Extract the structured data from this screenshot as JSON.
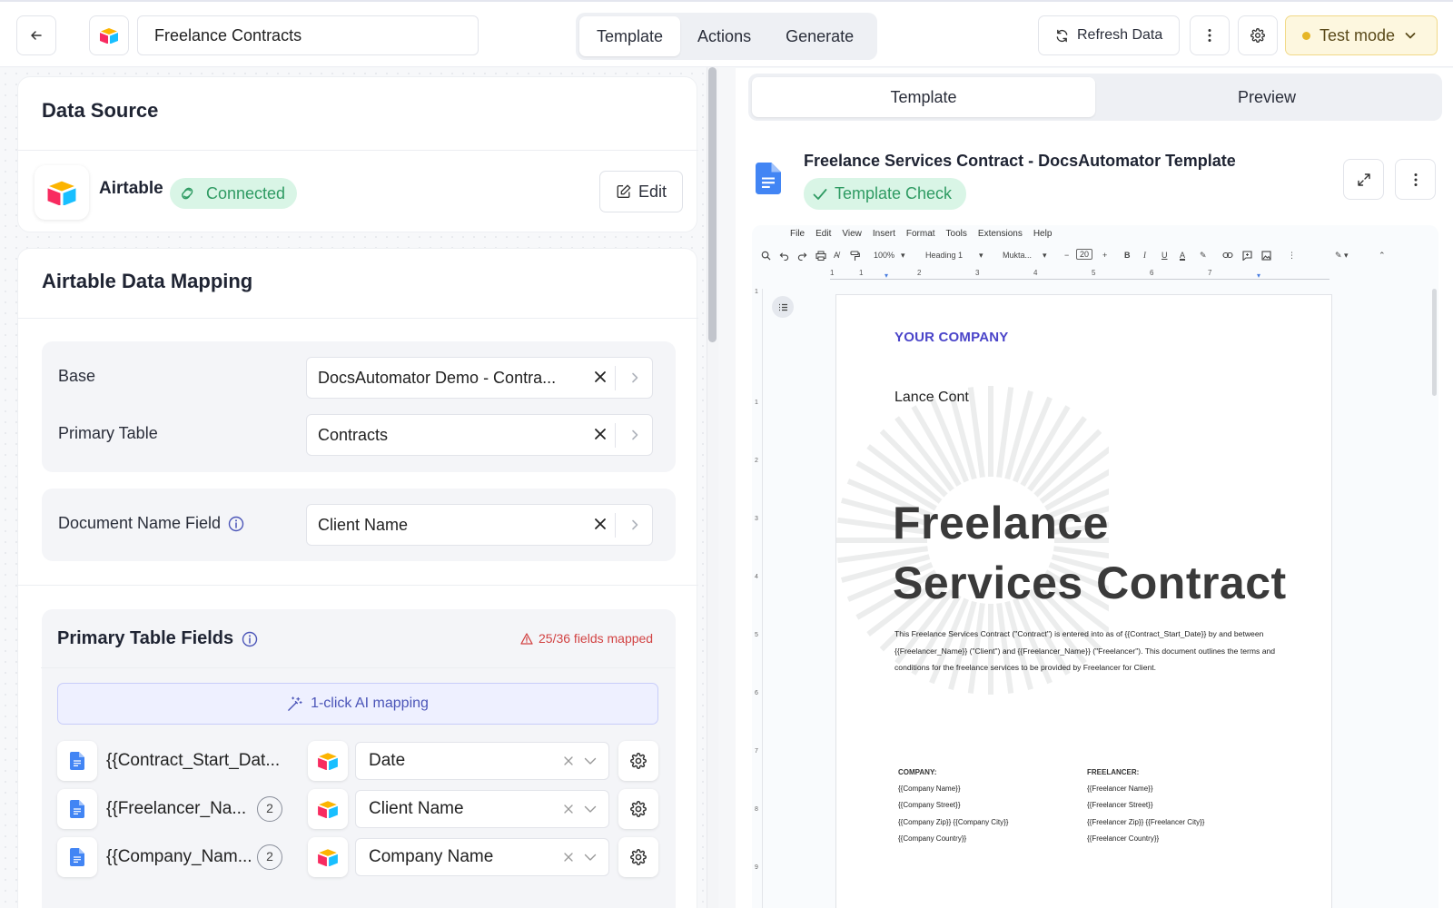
{
  "header": {
    "title": "Freelance Contracts",
    "tabs": [
      "Template",
      "Actions",
      "Generate"
    ],
    "refresh_label": "Refresh Data",
    "test_mode_label": "Test mode"
  },
  "data_source": {
    "title": "Data Source",
    "provider": "Airtable",
    "status": "Connected",
    "edit_label": "Edit"
  },
  "mapping": {
    "title": "Airtable Data Mapping",
    "base_label": "Base",
    "base_value": "DocsAutomator Demo - Contra...",
    "table_label": "Primary Table",
    "table_value": "Contracts",
    "docname_label": "Document Name Field",
    "docname_value": "Client Name"
  },
  "fields": {
    "title": "Primary Table Fields",
    "mapped_status": "25/36 fields mapped",
    "ai_button": "1-click AI mapping",
    "rows": [
      {
        "placeholder": "{{Contract_Start_Dat...",
        "count": "",
        "value": "Date"
      },
      {
        "placeholder": "{{Freelancer_Na...",
        "count": "2",
        "value": "Client Name"
      },
      {
        "placeholder": "{{Company_Nam...",
        "count": "2",
        "value": "Company Name"
      }
    ]
  },
  "preview": {
    "tabs": [
      "Template",
      "Preview"
    ],
    "doc_title": "Freelance Services Contract - DocsAutomator Template",
    "check_label": "Template Check"
  },
  "gdoc": {
    "menu": [
      "File",
      "Edit",
      "View",
      "Insert",
      "Format",
      "Tools",
      "Extensions",
      "Help"
    ],
    "zoom": "100%",
    "style": "Heading 1",
    "font": "Mukta...",
    "font_size": "20",
    "ruler": [
      "1",
      "1",
      "2",
      "3",
      "4",
      "5",
      "6",
      "7"
    ],
    "vruler": [
      "1",
      "1",
      "2",
      "3",
      "4",
      "5",
      "6",
      "7",
      "8",
      "9"
    ],
    "company_header": "YOUR COMPANY",
    "author": "Lance Cont",
    "heading_line1": "Freelance",
    "heading_line2": "Services Contract",
    "intro_text": "This Freelance Services Contract (\"Contract\") is entered into as of {{Contract_Start_Date}} by and between {{Freelancer_Name}} (\"Client\") and {{Freelancer_Name}} (\"Freelancer\"). This document outlines the terms and conditions for the freelance services to be provided by Freelancer for Client.",
    "company_col_title": "COMPANY:",
    "company_lines": [
      "{{Company Name}}",
      "{{Company Street}}",
      "{{Company Zip}} {{Company City}}",
      "{{Company Country}}"
    ],
    "freelancer_col_title": "FREELANCER:",
    "freelancer_lines": [
      "{{Freelancer Name}}",
      "{{Freelancer Street}}",
      "{{Freelancer Zip}} {{Freelancer City}}",
      "{{Freelancer Country}}"
    ]
  },
  "colors": {
    "accent_green": "#2f9b63",
    "accent_purple": "#4a44c9",
    "warning_red": "#d24343",
    "test_mode_yellow": "#e6b627"
  }
}
